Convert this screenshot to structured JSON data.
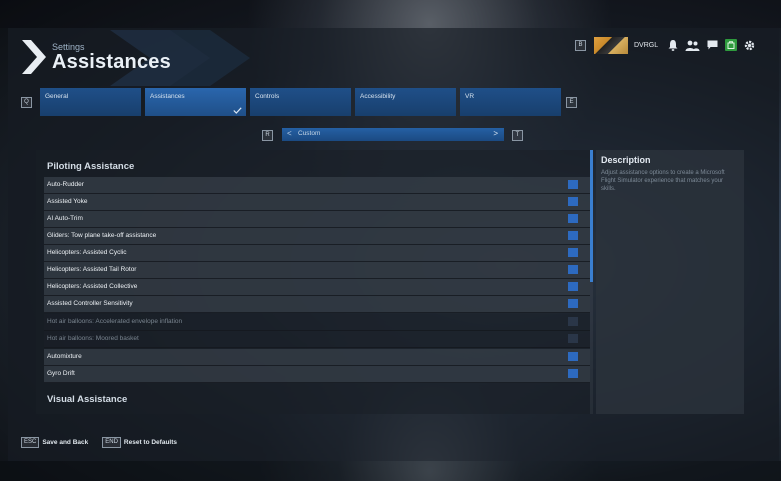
{
  "header": {
    "breadcrumb": "Settings",
    "title": "Assistances",
    "key_b": "B",
    "username": "DVRGL"
  },
  "tabs": {
    "key_prev": "Q",
    "key_next": "E",
    "items": [
      {
        "label": "General",
        "active": false
      },
      {
        "label": "Assistances",
        "active": true
      },
      {
        "label": "Controls",
        "active": false
      },
      {
        "label": "Accessibility",
        "active": false
      },
      {
        "label": "VR",
        "active": false
      }
    ]
  },
  "preset": {
    "key_prev": "R",
    "key_next": "T",
    "value": "Custom",
    "prev_glyph": "<",
    "next_glyph": ">"
  },
  "sections": {
    "piloting": {
      "title": "Piloting Assistance",
      "rows": [
        {
          "label": "Auto-Rudder",
          "enabled": true
        },
        {
          "label": "Assisted Yoke",
          "enabled": true
        },
        {
          "label": "AI Auto-Trim",
          "enabled": true
        },
        {
          "label": "Gliders: Tow plane take-off assistance",
          "enabled": true
        },
        {
          "label": "Helicopters: Assisted Cyclic",
          "enabled": true
        },
        {
          "label": "Helicopters: Assisted Tail Rotor",
          "enabled": true
        },
        {
          "label": "Helicopters: Assisted Collective",
          "enabled": true
        },
        {
          "label": "Assisted Controller Sensitivity",
          "enabled": true
        },
        {
          "label": "Hot air balloons: Accelerated envelope inflation",
          "enabled": false
        },
        {
          "label": "Hot air balloons: Moored basket",
          "enabled": false
        },
        {
          "label": "Automixture",
          "enabled": true
        },
        {
          "label": "Gyro Drift",
          "enabled": true
        }
      ]
    },
    "visual": {
      "title": "Visual Assistance"
    }
  },
  "description": {
    "title": "Description",
    "text": "Adjust assistance options to create a Microsoft Flight Simulator experience that matches your skills."
  },
  "footer": {
    "save_key": "ESC",
    "save_label": "Save and Back",
    "reset_key": "END",
    "reset_label": "Reset to Defaults"
  },
  "colors": {
    "accent": "#2d6ac0",
    "tab_bg": "#1f4f88",
    "panel_bg": "#1c232c"
  },
  "icons": {
    "header": [
      "notification-bell-icon",
      "friends-icon",
      "chat-icon",
      "marketplace-icon",
      "settings-gear-icon"
    ]
  }
}
